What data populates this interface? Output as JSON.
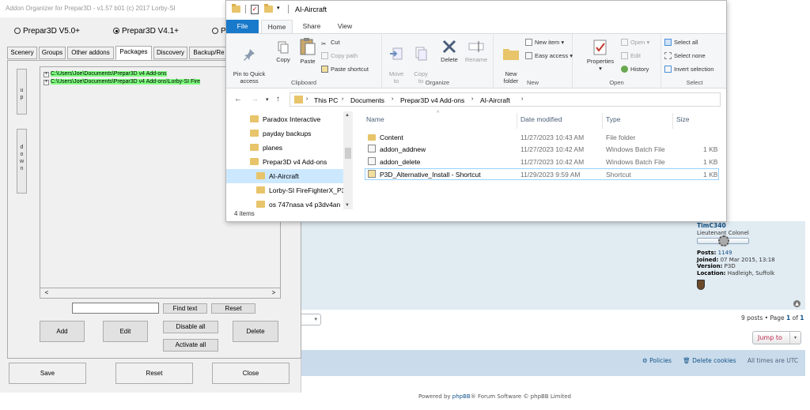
{
  "addon": {
    "title": "Addon Organizer for Prepar3D - v1.57 b01 (c) 2017 Lorby-SI",
    "radios": [
      {
        "label": "Prepar3D V5.0+",
        "selected": false
      },
      {
        "label": "Prepar3D V4.1+",
        "selected": true
      },
      {
        "label": "P",
        "selected": false
      }
    ],
    "tabs": [
      "Scenery",
      "Groups",
      "Other addons",
      "Packages",
      "Discovery",
      "Backup/Re"
    ],
    "active_tab": "Packages",
    "up_label": "u\np",
    "down_label": "d\no\nw\nn",
    "tree_items": [
      "C:\\Users\\Joe\\Documents\\Prepar3D v4 Add-ons",
      "C:\\Users\\Joe\\Documents\\Prepar3D v4 Add-ons\\Lorby-SI Fire"
    ],
    "tree_toggle": "+",
    "scroll_left": "<",
    "scroll_right": ">",
    "find_text_label": "Find text",
    "reset_label": "Reset",
    "add_label": "Add",
    "edit_label": "Edit",
    "disable_all_label": "Disable all",
    "activate_all_label": "Activate all",
    "delete_label": "Delete",
    "save_label": "Save",
    "reset_bottom_label": "Reset",
    "close_label": "Close"
  },
  "explorer": {
    "window_title": "AI-Aircraft",
    "ribbon_tabs": [
      "File",
      "Home",
      "Share",
      "View"
    ],
    "clipboard": {
      "pin": "Pin to Quick\naccess",
      "copy": "Copy",
      "paste": "Paste",
      "cut": "Cut",
      "copy_path": "Copy path",
      "paste_shortcut": "Paste shortcut",
      "group": "Clipboard"
    },
    "organize": {
      "move_to": "Move\nto",
      "copy_to": "Copy\nto",
      "delete": "Delete",
      "rename": "Rename",
      "group": "Organize"
    },
    "new": {
      "new_folder": "New\nfolder",
      "new_item": "New item",
      "easy_access": "Easy access",
      "group": "New"
    },
    "open": {
      "properties": "Properties",
      "open": "Open",
      "edit": "Edit",
      "history": "History",
      "group": "Open"
    },
    "select": {
      "select_all": "Select all",
      "select_none": "Select none",
      "invert": "Invert selection",
      "group": "Select"
    },
    "breadcrumb": [
      "This PC",
      "Documents",
      "Prepar3D v4 Add-ons",
      "AI-Aircraft"
    ],
    "nav_items": [
      {
        "label": "Paradox Interactive",
        "selected": false,
        "indent": false
      },
      {
        "label": "payday backups",
        "selected": false,
        "indent": false
      },
      {
        "label": "planes",
        "selected": false,
        "indent": false
      },
      {
        "label": "Prepar3D v4 Add-ons",
        "selected": false,
        "indent": false
      },
      {
        "label": "AI-Aircraft",
        "selected": true,
        "indent": true
      },
      {
        "label": "Lorby-SI FireFighterX_P3",
        "selected": false,
        "indent": true
      },
      {
        "label": "os 747nasa v4 p3dv4an",
        "selected": false,
        "indent": true
      }
    ],
    "item_count": "4 items",
    "columns": [
      "Name",
      "Date modified",
      "Type",
      "Size"
    ],
    "files": [
      {
        "name": "Content",
        "date": "11/27/2023 10:43 AM",
        "type": "File folder",
        "size": "",
        "icon": "folder-icon",
        "selected": false
      },
      {
        "name": "addon_addnew",
        "date": "11/27/2023 10:42 AM",
        "type": "Windows Batch File",
        "size": "1 KB",
        "icon": "batch-file-icon",
        "selected": false
      },
      {
        "name": "addon_delete",
        "date": "11/27/2023 10:42 AM",
        "type": "Windows Batch File",
        "size": "1 KB",
        "icon": "batch-file-icon",
        "selected": false
      },
      {
        "name": "P3D_Alternative_Install - Shortcut",
        "date": "11/29/2023 9:59 AM",
        "type": "Shortcut",
        "size": "1 KB",
        "icon": "shortcut-icon",
        "selected": true
      }
    ]
  },
  "forum": {
    "username": "TimC340",
    "rank": "Lieutenant Colonel",
    "posts_label": "Posts:",
    "posts_value": "1149",
    "joined_label": "Joined:",
    "joined_value": "07 Mar 2015, 13:18",
    "version_label": "Version:",
    "version_value": "P3D",
    "location_label": "Location:",
    "location_value": "Hadleigh, Suffolk",
    "page_select_arrow": "▾",
    "pagination_prefix": "9 posts • Page ",
    "pagination_current": "1",
    "pagination_of": " of ",
    "pagination_total": "1",
    "jump_to": "Jump to",
    "jump_arrow": "▾",
    "policies": "Policies",
    "delete_cookies": "Delete cookies",
    "timezone": "All times are UTC",
    "powered_prefix": "Powered by ",
    "powered_link": "phpBB",
    "powered_suffix": "® Forum Software © phpBB Limited",
    "top_arrow": "▲"
  }
}
